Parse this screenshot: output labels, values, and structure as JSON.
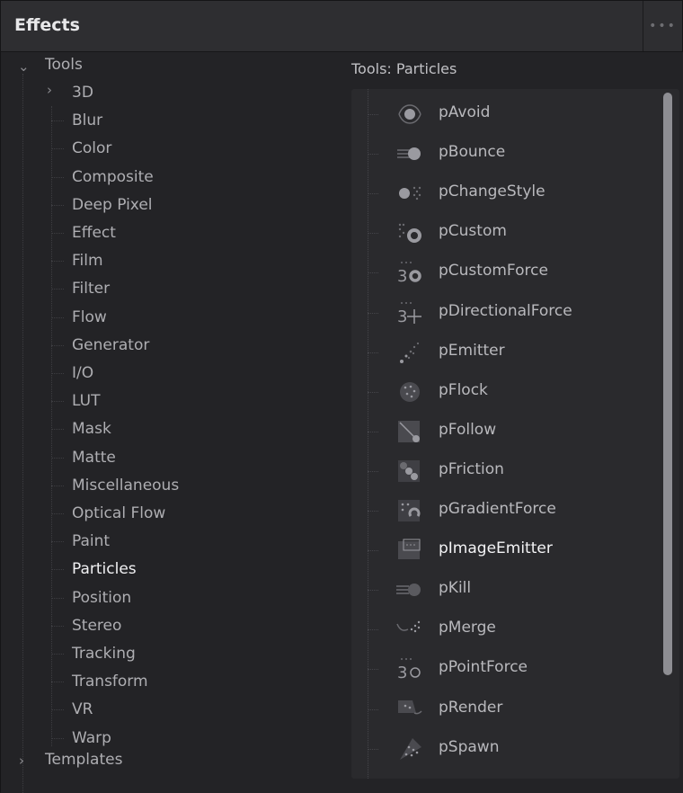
{
  "panel": {
    "title": "Effects",
    "menu_glyph": "•••"
  },
  "tree": {
    "root": {
      "label": "Tools",
      "expanded": true
    },
    "children": [
      {
        "label": "3D",
        "expandable": true
      },
      {
        "label": "Blur"
      },
      {
        "label": "Color"
      },
      {
        "label": "Composite"
      },
      {
        "label": "Deep Pixel"
      },
      {
        "label": "Effect"
      },
      {
        "label": "Film"
      },
      {
        "label": "Filter"
      },
      {
        "label": "Flow"
      },
      {
        "label": "Generator"
      },
      {
        "label": "I/O"
      },
      {
        "label": "LUT"
      },
      {
        "label": "Mask"
      },
      {
        "label": "Matte"
      },
      {
        "label": "Miscellaneous"
      },
      {
        "label": "Optical Flow"
      },
      {
        "label": "Paint"
      },
      {
        "label": "Particles",
        "selected": true
      },
      {
        "label": "Position"
      },
      {
        "label": "Stereo"
      },
      {
        "label": "Tracking"
      },
      {
        "label": "Transform"
      },
      {
        "label": "VR"
      },
      {
        "label": "Warp"
      }
    ],
    "templates": {
      "label": "Templates",
      "expanded": false
    }
  },
  "tools": {
    "heading": "Tools: Particles",
    "items": [
      {
        "label": "pAvoid",
        "icon": "avoid-icon"
      },
      {
        "label": "pBounce",
        "icon": "bounce-icon"
      },
      {
        "label": "pChangeStyle",
        "icon": "change-style-icon"
      },
      {
        "label": "pCustom",
        "icon": "custom-gear-icon"
      },
      {
        "label": "pCustomForce",
        "icon": "custom-force-icon"
      },
      {
        "label": "pDirectionalForce",
        "icon": "directional-force-icon"
      },
      {
        "label": "pEmitter",
        "icon": "emitter-icon"
      },
      {
        "label": "pFlock",
        "icon": "flock-icon"
      },
      {
        "label": "pFollow",
        "icon": "follow-icon"
      },
      {
        "label": "pFriction",
        "icon": "friction-icon"
      },
      {
        "label": "pGradientForce",
        "icon": "gradient-force-icon"
      },
      {
        "label": "pImageEmitter",
        "icon": "image-emitter-icon",
        "highlighted": true
      },
      {
        "label": "pKill",
        "icon": "kill-icon"
      },
      {
        "label": "pMerge",
        "icon": "merge-icon"
      },
      {
        "label": "pPointForce",
        "icon": "point-force-icon"
      },
      {
        "label": "pRender",
        "icon": "render-icon"
      },
      {
        "label": "pSpawn",
        "icon": "spawn-icon"
      }
    ]
  },
  "colors": {
    "background": "#232326",
    "header": "#2e2e31",
    "text": "#aeaeb2",
    "selected_text": "#f1f1f3"
  }
}
